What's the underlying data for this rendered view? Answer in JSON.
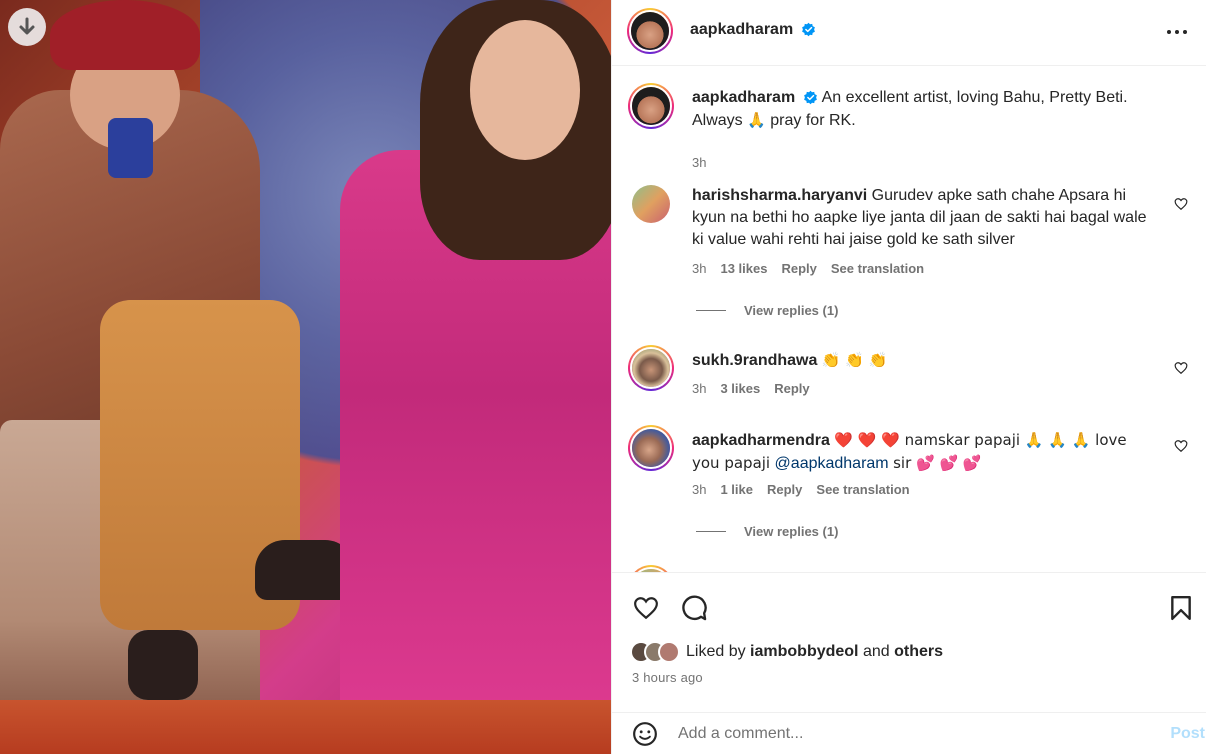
{
  "post": {
    "author": "aapkadharam",
    "caption_user": "aapkadharam",
    "caption_line1": "An excellent artist, loving Bahu, Pretty Beti.",
    "caption_line2_a": "Always",
    "caption_line2_emoji": "🙏",
    "caption_line2_b": "pray for RK.",
    "caption_time": "3h"
  },
  "comments": [
    {
      "user": "harishsharma.haryanvi",
      "text": "Gurudev apke sath chahe Apsara hi kyun na bethi ho aapke liye janta dil jaan de sakti hai bagal wale ki value wahi rehti hai jaise gold ke sath silver",
      "time": "3h",
      "likes": "13 likes",
      "reply": "Reply",
      "translate": "See translation",
      "view_replies": "View replies (1)"
    },
    {
      "user": "sukh.9randhawa",
      "text": "👏 👏 👏",
      "time": "3h",
      "likes": "3 likes",
      "reply": "Reply"
    },
    {
      "user": "aapkadharmendra",
      "text_a": "❤️ ❤️ ❤️ namskar papaji 🙏 🙏 🙏 love you papaji",
      "mention": "@aapkadharam",
      "text_b": "sir 💕 💕 💕",
      "time": "3h",
      "likes": "1 like",
      "reply": "Reply",
      "translate": "See translation",
      "view_replies": "View replies (1)"
    }
  ],
  "likes": {
    "prefix": "Liked by",
    "user": "iambobbydeol",
    "and": "and",
    "others": "others"
  },
  "timestamp": "3 hours ago",
  "add_comment": {
    "placeholder": "Add a comment...",
    "post_label": "Post"
  },
  "colors": {
    "verified": "#0095f6",
    "mention": "#00376b",
    "post_disabled": "#b2dffc",
    "secondary_text": "#737373"
  }
}
